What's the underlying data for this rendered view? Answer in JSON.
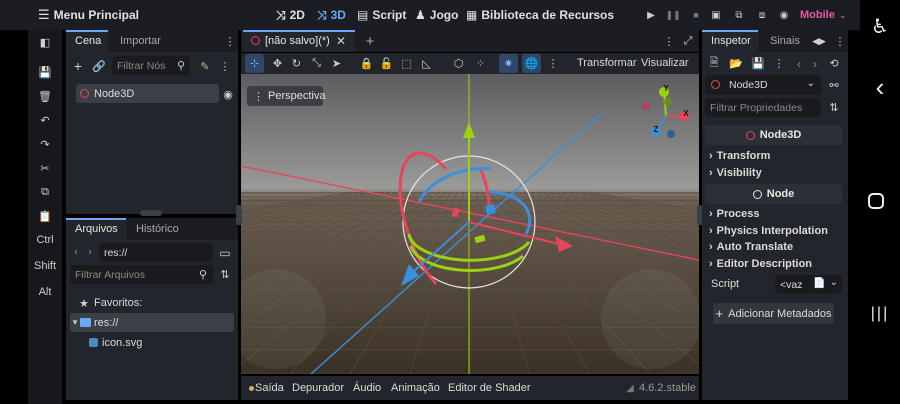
{
  "topbar": {
    "menu_label": "Menu Principal",
    "btn_2d": "2D",
    "btn_3d": "3D",
    "btn_script": "Script",
    "btn_game": "Jogo",
    "btn_assetlib": "Biblioteca de Recursos",
    "renderer": "Mobile"
  },
  "lefttools": {
    "ctrl": "Ctrl",
    "shift": "Shift",
    "alt": "Alt"
  },
  "scene_dock": {
    "tab_scene": "Cena",
    "tab_import": "Importar",
    "filter_placeholder": "Filtrar Nós",
    "root_node": "Node3D"
  },
  "filesystem_dock": {
    "tab_files": "Arquivos",
    "tab_history": "Histórico",
    "path": "res://",
    "filter_placeholder": "Filtrar Arquivos",
    "favorites": "Favoritos:",
    "root_folder": "res://",
    "file_icon": "icon.svg"
  },
  "editor": {
    "scene_tab": "[não salvo](*)",
    "menu_transform": "Transformar",
    "menu_view": "Visualizar",
    "perspective": "Perspectiva",
    "gizmo_y": "Y",
    "gizmo_x": "X",
    "gizmo_z": "Z"
  },
  "bottom_panel": {
    "output": "Saída",
    "debugger": "Depurador",
    "audio": "Áudio",
    "animation": "Animação",
    "shader_editor": "Editor de Shader",
    "version": "4.6.2.stable"
  },
  "inspector": {
    "tab_inspector": "Inspetor",
    "tab_signals": "Sinais",
    "object_name": "Node3D",
    "filter_placeholder": "Filtrar Propriedades",
    "section_node3d": "Node3D",
    "prop_transform": "Transform",
    "prop_visibility": "Visibility",
    "section_node": "Node",
    "prop_process": "Process",
    "prop_physics_interp": "Physics Interpolation",
    "prop_auto_translate": "Auto Translate",
    "prop_editor_desc": "Editor Description",
    "script_label": "Script",
    "script_value": "<vaz",
    "add_metadata": "Adicionar Metadados"
  },
  "colors": {
    "accent": "#6aa8ff",
    "renderer": "#e05ca9",
    "x_axis": "#e8455c",
    "y_axis": "#9ad20f",
    "z_axis": "#3a8fe0",
    "panel": "#22252b"
  }
}
